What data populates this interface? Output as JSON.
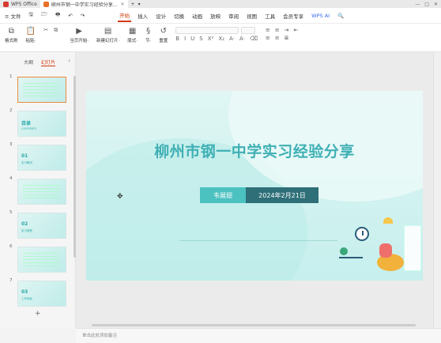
{
  "titlebar": {
    "tabs": [
      {
        "label": "WPS Office",
        "active": false,
        "logo_color": "#d63a2f"
      },
      {
        "label": "柳州市钢一中学实习经验分享...",
        "active": true,
        "logo_color": "#e8702a"
      }
    ],
    "new_tab": "+",
    "new_tab_dropdown": "▾",
    "controls": [
      "—",
      "□",
      "✕"
    ]
  },
  "menubar": {
    "file_menu": "≡ 文件",
    "quick_icons": [
      "🖫",
      "🗁",
      "🖶",
      "↶",
      "↷"
    ],
    "tabs": [
      "开始",
      "插入",
      "设计",
      "切换",
      "动画",
      "放映",
      "审阅",
      "视图",
      "工具",
      "会员专享"
    ],
    "active_tab": "开始",
    "wps_ai": "WPS AI",
    "share": "🔍"
  },
  "ribbon": {
    "groups": [
      {
        "icon": "⧉",
        "label": "格式刷"
      },
      {
        "icon": "📋",
        "label": "粘贴·"
      },
      {
        "icon": "✂",
        "label": ""
      },
      {
        "icon": "▶",
        "label": "当页开始·"
      },
      {
        "icon": "▤",
        "label": "新建幻灯片·"
      },
      {
        "icon": "▦",
        "label": "版式·"
      },
      {
        "icon": "§",
        "label": "节·"
      },
      {
        "icon": "↺",
        "label": "重置"
      }
    ],
    "format_row": [
      "B",
      "I",
      "U",
      "S",
      "X²",
      "X₂",
      "A·",
      "A·",
      "⌫"
    ],
    "para_row": [
      "≡",
      "≡",
      "≡",
      "≡",
      "≣",
      "⇥",
      "⇤"
    ]
  },
  "sidepanel": {
    "tabs": [
      "大纲",
      "幻灯片"
    ],
    "active_tab": "幻灯片",
    "collapse": "‹",
    "slides": [
      {
        "num": "1",
        "label": "",
        "sub": ""
      },
      {
        "num": "2",
        "label": "目录",
        "sub": "CONTENTS"
      },
      {
        "num": "3",
        "label": "01",
        "sub": "实习概况"
      },
      {
        "num": "4",
        "label": "",
        "sub": ""
      },
      {
        "num": "5",
        "label": "02",
        "sub": "实习收获"
      },
      {
        "num": "6",
        "label": "",
        "sub": ""
      },
      {
        "num": "7",
        "label": "03",
        "sub": "工作体会"
      },
      {
        "num": "8",
        "label": "",
        "sub": ""
      }
    ],
    "add_slide": "+"
  },
  "slide": {
    "title": "柳州市钢一中学实习经验分享",
    "author": "韦展翅",
    "date": "2024年2月21日",
    "bg_color": "#c6efed",
    "title_color": "#3fb0b5"
  },
  "notes": {
    "placeholder": "单击此处添加备注"
  }
}
